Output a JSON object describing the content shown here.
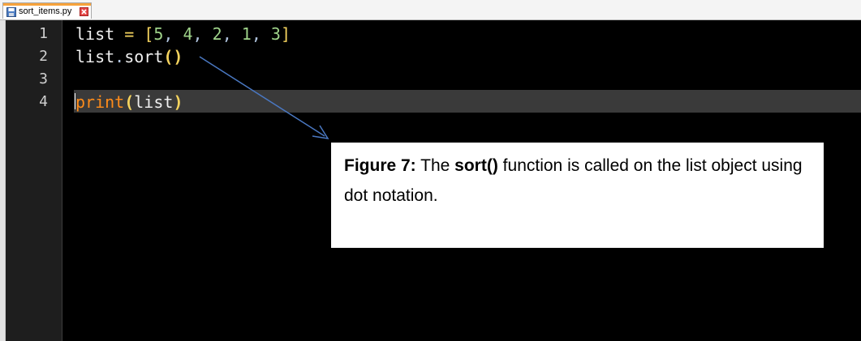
{
  "tab": {
    "filename": "sort_items.py",
    "icon": "save-icon",
    "close_icon": "close-icon"
  },
  "gutter": {
    "line_numbers": [
      "1",
      "2",
      "3",
      "4"
    ]
  },
  "code": {
    "line1": {
      "ident": "list",
      "op": "=",
      "open": "[",
      "n1": "5",
      "n2": "4",
      "n3": "2",
      "n4": "1",
      "n5": "3",
      "sep": ",",
      "close": "]"
    },
    "line2": {
      "ident": "list",
      "dot": ".",
      "method": "sort",
      "parens": "()"
    },
    "line4": {
      "keyword": "print",
      "open": "(",
      "ident": "list",
      "close": ")"
    }
  },
  "callout": {
    "figure_label": "Figure 7:",
    "text_1": " The ",
    "method": "sort()",
    "text_2": " function is called on the list object using dot notation."
  },
  "colors": {
    "editor_bg": "#000000",
    "current_line_bg": "#3a3a3a",
    "keyword": "#ff8c1a",
    "number": "#9fd38a",
    "operator": "#f4d35e",
    "arrow": "#4a78c2"
  }
}
